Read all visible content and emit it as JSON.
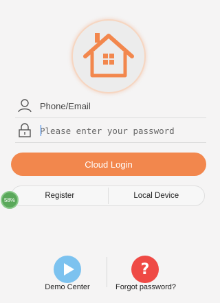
{
  "login": {
    "phone_placeholder": "Phone/Email",
    "password_placeholder": "Please enter your password",
    "cloud_login_label": "Cloud Login"
  },
  "options": {
    "register_label": "Register",
    "local_device_label": "Local Device"
  },
  "overlay": {
    "badge_text": "58%"
  },
  "bottom": {
    "demo_center_label": "Demo Center",
    "forgot_password_label": "Forgot password?"
  },
  "icons": {
    "logo": "house-logo-icon",
    "user": "user-icon",
    "lock": "lock-icon",
    "play": "play-icon",
    "help": "question-mark-icon"
  },
  "colors": {
    "accent": "#f2874d",
    "demo": "#7cc2ef",
    "help": "#ef4a45",
    "badge": "#5aa85a"
  }
}
